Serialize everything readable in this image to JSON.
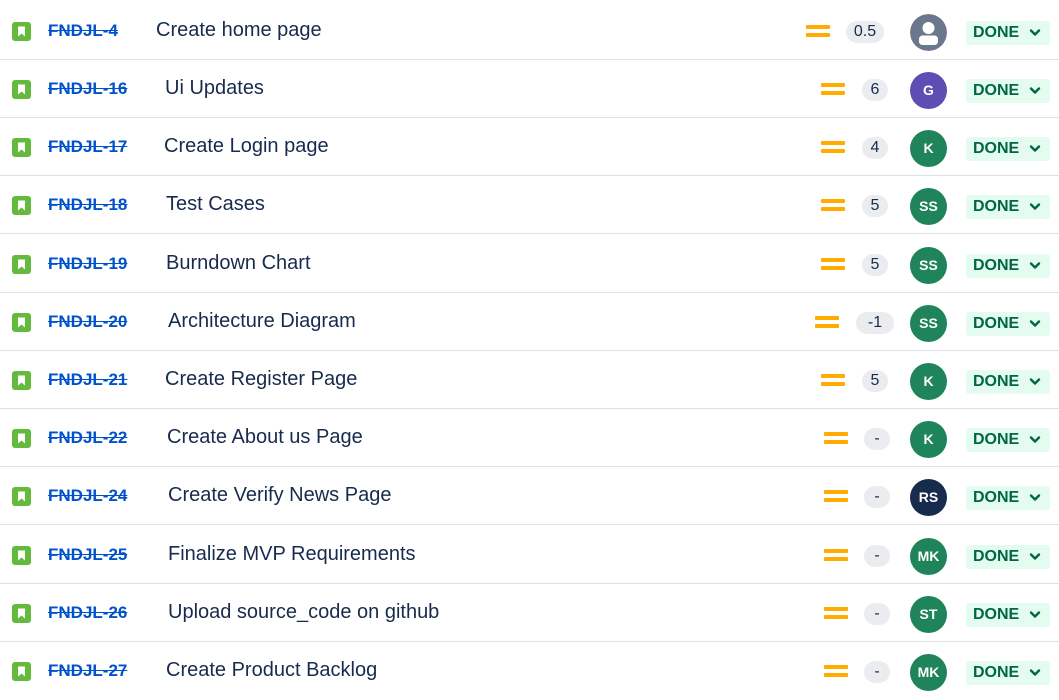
{
  "status_label": "DONE",
  "colors": {
    "story_icon": "#63ba3c",
    "issue_key": "#0052cc",
    "priority_medium": "#ffab00",
    "status_bg": "#e3fcef",
    "status_text": "#006644"
  },
  "issues": [
    {
      "key": "FNDJL-4",
      "summary": "Create home page",
      "points": "0.5",
      "assignee": "",
      "avatar_color": "#6b778c",
      "avatar_icon": "default-user-avatar-icon"
    },
    {
      "key": "FNDJL-16",
      "summary": "Ui Updates",
      "points": "6",
      "assignee": "G",
      "avatar_color": "#5e4db2"
    },
    {
      "key": "FNDJL-17",
      "summary": "Create Login page",
      "points": "4",
      "assignee": "K",
      "avatar_color": "#1f845a"
    },
    {
      "key": "FNDJL-18",
      "summary": "Test Cases",
      "points": "5",
      "assignee": "SS",
      "avatar_color": "#1f845a"
    },
    {
      "key": "FNDJL-19",
      "summary": "Burndown Chart",
      "points": "5",
      "assignee": "SS",
      "avatar_color": "#1f845a"
    },
    {
      "key": "FNDJL-20",
      "summary": "Architecture Diagram",
      "points": "-1",
      "assignee": "SS",
      "avatar_color": "#1f845a"
    },
    {
      "key": "FNDJL-21",
      "summary": "Create Register Page",
      "points": "5",
      "assignee": "K",
      "avatar_color": "#1f845a"
    },
    {
      "key": "FNDJL-22",
      "summary": "Create About us Page",
      "points": "-",
      "assignee": "K",
      "avatar_color": "#1f845a"
    },
    {
      "key": "FNDJL-24",
      "summary": "Create Verify News Page",
      "points": "-",
      "assignee": "RS",
      "avatar_color": "#172b4d"
    },
    {
      "key": "FNDJL-25",
      "summary": "Finalize MVP Requirements",
      "points": "-",
      "assignee": "MK",
      "avatar_color": "#1f845a"
    },
    {
      "key": "FNDJL-26",
      "summary": "Upload source_code on github",
      "points": "-",
      "assignee": "ST",
      "avatar_color": "#1f845a"
    },
    {
      "key": "FNDJL-27",
      "summary": "Create Product Backlog",
      "points": "-",
      "assignee": "MK",
      "avatar_color": "#1f845a"
    }
  ]
}
